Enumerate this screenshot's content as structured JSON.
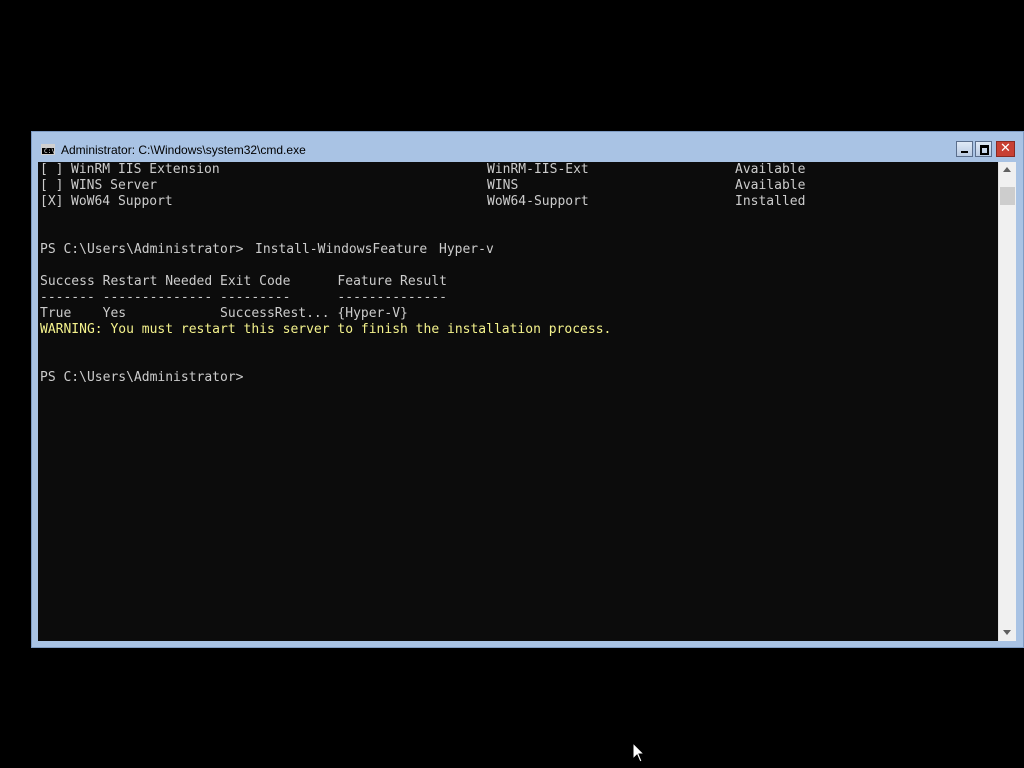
{
  "window": {
    "title": "Administrator: C:\\Windows\\system32\\cmd.exe",
    "icon": "cmd-icon"
  },
  "controls": {
    "minimize_icon": "minimize-icon",
    "maximize_icon": "maximize-icon",
    "close_icon": "close-icon",
    "close_glyph": "✕"
  },
  "console": {
    "feature_rows": [
      {
        "check": "[ ]",
        "name": "WinRM IIS Extension",
        "id": "WinRM-IIS-Ext",
        "state": "Available"
      },
      {
        "check": "[ ]",
        "name": "WINS Server",
        "id": "WINS",
        "state": "Available"
      },
      {
        "check": "[X]",
        "name": "WoW64 Support",
        "id": "WoW64-Support",
        "state": "Installed"
      }
    ],
    "prompt": "PS C:\\Users\\Administrator>",
    "command": "Install-WindowsFeature",
    "command_arg": "Hyper-v",
    "result_header": "Success Restart Needed Exit Code      Feature Result",
    "result_separator": "------- -------------- ---------      --------------",
    "result_row": "True    Yes            SuccessRest... {Hyper-V}",
    "warning": "WARNING: You must restart this server to finish the installation process.",
    "final_prompt": "PS C:\\Users\\Administrator>",
    "colors": {
      "background": "#0c0c0c",
      "text": "#cccccc",
      "warning": "#f4f28c"
    }
  }
}
